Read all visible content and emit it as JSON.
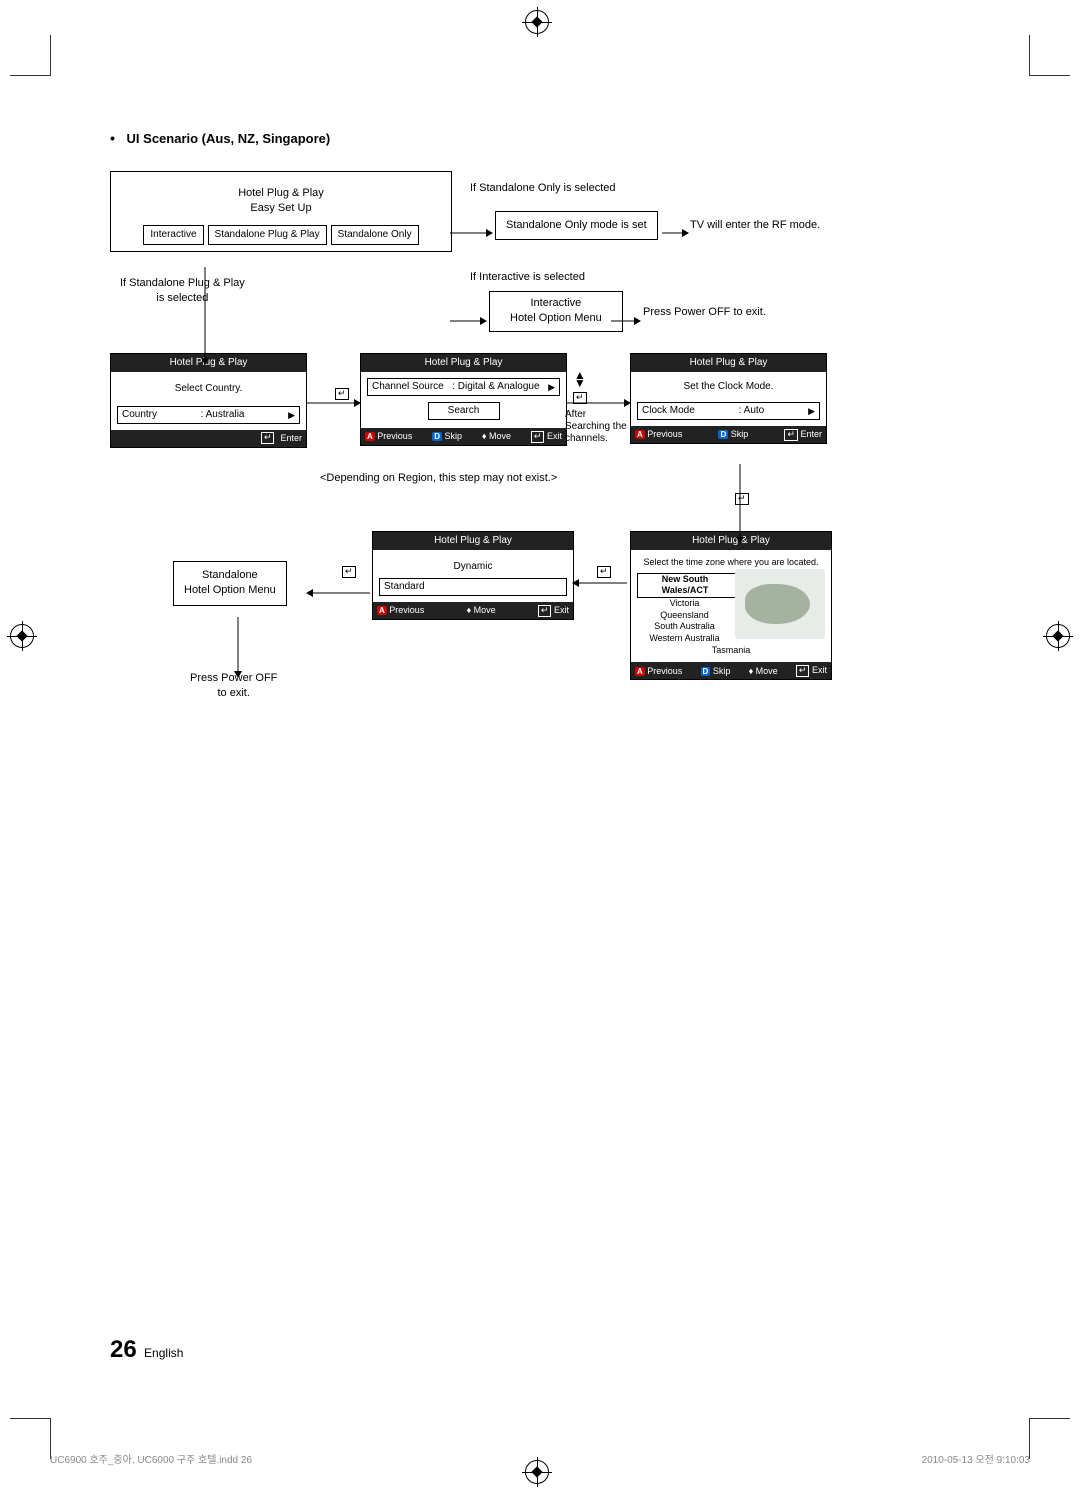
{
  "heading": "UI Scenario (Aus, NZ, Singapore)",
  "topBox": {
    "line1": "Hotel Plug & Play",
    "line2": "Easy Set Up",
    "opt1": "Interactive",
    "opt2": "Standalone Plug & Play",
    "opt3": "Standalone Only"
  },
  "branchStandalone": "If Standalone Only is selected",
  "standaloneSet": "Standalone Only mode is set",
  "tvRf": "TV will enter the RF mode.",
  "branchInteractive": "If Interactive is selected",
  "interactiveBox": {
    "line1": "Interactive",
    "line2": "Hotel Option Menu"
  },
  "powerOffExit": "Press Power OFF to exit.",
  "branchPlugPlay": {
    "line1": "If Standalone Plug & Play",
    "line2": "is selected"
  },
  "panelCountry": {
    "title": "Hotel Plug & Play",
    "text": "Select Country.",
    "fieldLabel": "Country",
    "fieldValue": ": Australia",
    "footEnter": "Enter"
  },
  "panelSource": {
    "title": "Hotel Plug & Play",
    "fieldLabel": "Channel Source",
    "fieldValue": ": Digital & Analogue",
    "search": "Search",
    "footPrev": "Previous",
    "footSkip": "Skip",
    "footMove": "Move",
    "footExit": "Exit"
  },
  "afterSearch": {
    "line1": "After",
    "line2": "Searching the",
    "line3": "channels."
  },
  "panelClock": {
    "title": "Hotel Plug & Play",
    "text": "Set the Clock Mode.",
    "fieldLabel": "Clock Mode",
    "fieldValue": ": Auto",
    "footPrev": "Previous",
    "footSkip": "Skip",
    "footEnter": "Enter"
  },
  "regionNote": "<Depending on Region, this step may not exist.>",
  "panelPicture": {
    "title": "Hotel Plug & Play",
    "opt1": "Dynamic",
    "opt2": "Standard",
    "footPrev": "Previous",
    "footMove": "Move",
    "footExit": "Exit"
  },
  "panelTz": {
    "title": "Hotel Plug & Play",
    "text": "Select the time zone where you are located.",
    "z1": "New South Wales/ACT",
    "z2": "Victoria",
    "z3": "Queensland",
    "z4": "South Australia",
    "z5": "Western Australia",
    "z6": "Tasmania",
    "footPrev": "Previous",
    "footSkip": "Skip",
    "footMove": "Move",
    "footExit": "Exit"
  },
  "standaloneMenu": {
    "line1": "Standalone",
    "line2": "Hotel Option Menu"
  },
  "powerOffExit2": {
    "line1": "Press Power OFF",
    "line2": "to exit."
  },
  "pageNum": "26",
  "pageLang": "English",
  "footLeft": "UC6900 호주_중아, UC6000 구주 호텔.indd   26",
  "footRight": "2010-05-13   오전 9:10:03"
}
